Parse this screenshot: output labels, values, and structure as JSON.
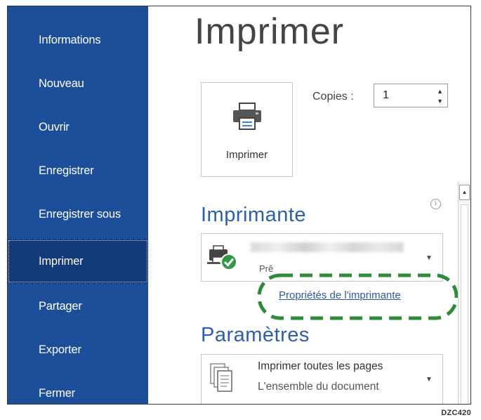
{
  "sidebar": {
    "items": [
      {
        "label": "Informations",
        "active": false
      },
      {
        "label": "Nouveau",
        "active": false
      },
      {
        "label": "Ouvrir",
        "active": false
      },
      {
        "label": "Enregistrer",
        "active": false
      },
      {
        "label": "Enregistrer sous",
        "active": false
      },
      {
        "label": "Imprimer",
        "active": true
      },
      {
        "label": "Partager",
        "active": false
      },
      {
        "label": "Exporter",
        "active": false
      },
      {
        "label": "Fermer",
        "active": false
      }
    ]
  },
  "main": {
    "title": "Imprimer",
    "print_button_label": "Imprimer",
    "copies_label": "Copies :",
    "copies_value": "1",
    "printer_section_title": "Imprimante",
    "printer_status": "Prê",
    "printer_properties_link": "Propriétés de l'imprimante",
    "settings_section_title": "Paramètres",
    "settings_line1": "Imprimer toutes les pages",
    "settings_line2": "L'ensemble du document"
  },
  "icons": {
    "print_button": "printer-icon",
    "printer_status": "printer-ready-icon",
    "pages": "pages-icon",
    "info": "info-icon"
  },
  "colors": {
    "sidebar_bg": "#1d4e9a",
    "sidebar_active_bg": "#123a78",
    "section_title": "#2c5fa7",
    "callout": "#2e8b3a"
  },
  "figure_code": "DZC420"
}
